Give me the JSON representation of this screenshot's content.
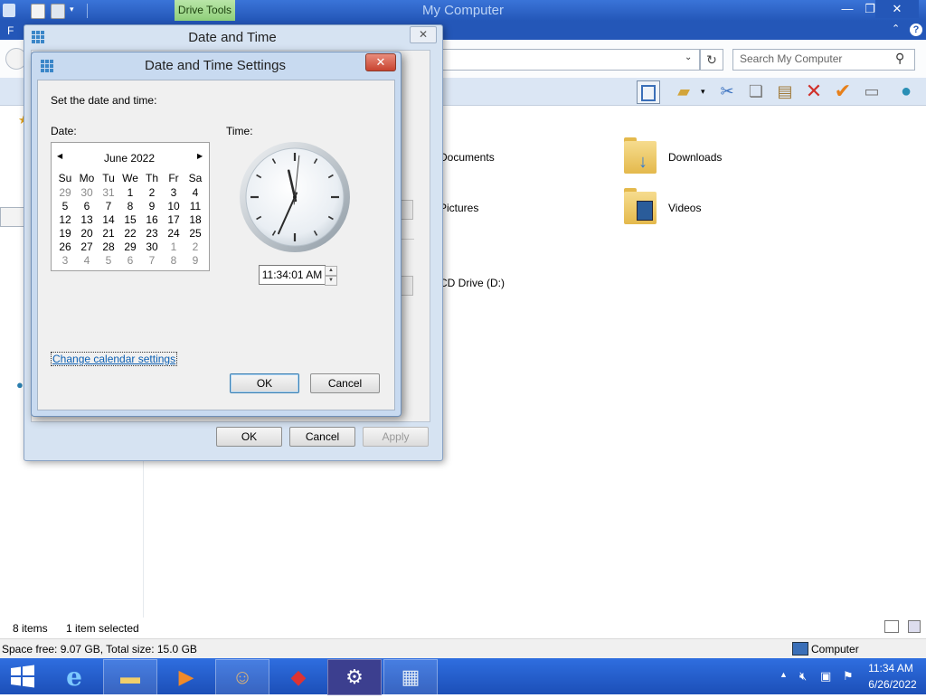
{
  "explorer": {
    "window_title": "My Computer",
    "contextual_tab": "Drive Tools",
    "file_tab": "F",
    "search_placeholder": "Search My Computer",
    "items": [
      {
        "label": "Documents"
      },
      {
        "label": "Downloads"
      },
      {
        "label": "Pictures"
      },
      {
        "label": "Videos"
      },
      {
        "label": "CD Drive (D:)"
      }
    ],
    "status": {
      "item_count": "8 items",
      "selected": "1 item selected",
      "space": "Space free: 9.07 GB, Total size: 15.0 GB",
      "location": "Computer"
    }
  },
  "date_time_dialog": {
    "title": "Date and Time",
    "ok": "OK",
    "cancel": "Cancel",
    "apply": "Apply"
  },
  "settings_dialog": {
    "title": "Date and Time Settings",
    "instruction": "Set the date and time:",
    "date_label": "Date:",
    "time_label": "Time:",
    "time_value": "11:34:01 AM",
    "change_calendar_link": "Change calendar settings",
    "ok": "OK",
    "cancel": "Cancel",
    "calendar": {
      "month_year": "June 2022",
      "weekdays": [
        "Su",
        "Mo",
        "Tu",
        "We",
        "Th",
        "Fr",
        "Sa"
      ],
      "weeks": [
        [
          "29",
          "30",
          "31",
          "1",
          "2",
          "3",
          "4"
        ],
        [
          "5",
          "6",
          "7",
          "8",
          "9",
          "10",
          "11"
        ],
        [
          "12",
          "13",
          "14",
          "15",
          "16",
          "17",
          "18"
        ],
        [
          "19",
          "20",
          "21",
          "22",
          "23",
          "24",
          "25"
        ],
        [
          "26",
          "27",
          "28",
          "29",
          "30",
          "1",
          "2"
        ],
        [
          "3",
          "4",
          "5",
          "6",
          "7",
          "8",
          "9"
        ]
      ],
      "muted": [
        [
          0,
          0
        ],
        [
          0,
          1
        ],
        [
          0,
          2
        ],
        [
          4,
          5
        ],
        [
          4,
          6
        ],
        [
          5,
          0
        ],
        [
          5,
          1
        ],
        [
          5,
          2
        ],
        [
          5,
          3
        ],
        [
          5,
          4
        ],
        [
          5,
          5
        ],
        [
          5,
          6
        ]
      ]
    },
    "clock": {
      "hour": 11,
      "minute": 34,
      "second": 1
    }
  },
  "taskbar": {
    "clock_time": "11:34 AM",
    "clock_date": "6/26/2022"
  }
}
